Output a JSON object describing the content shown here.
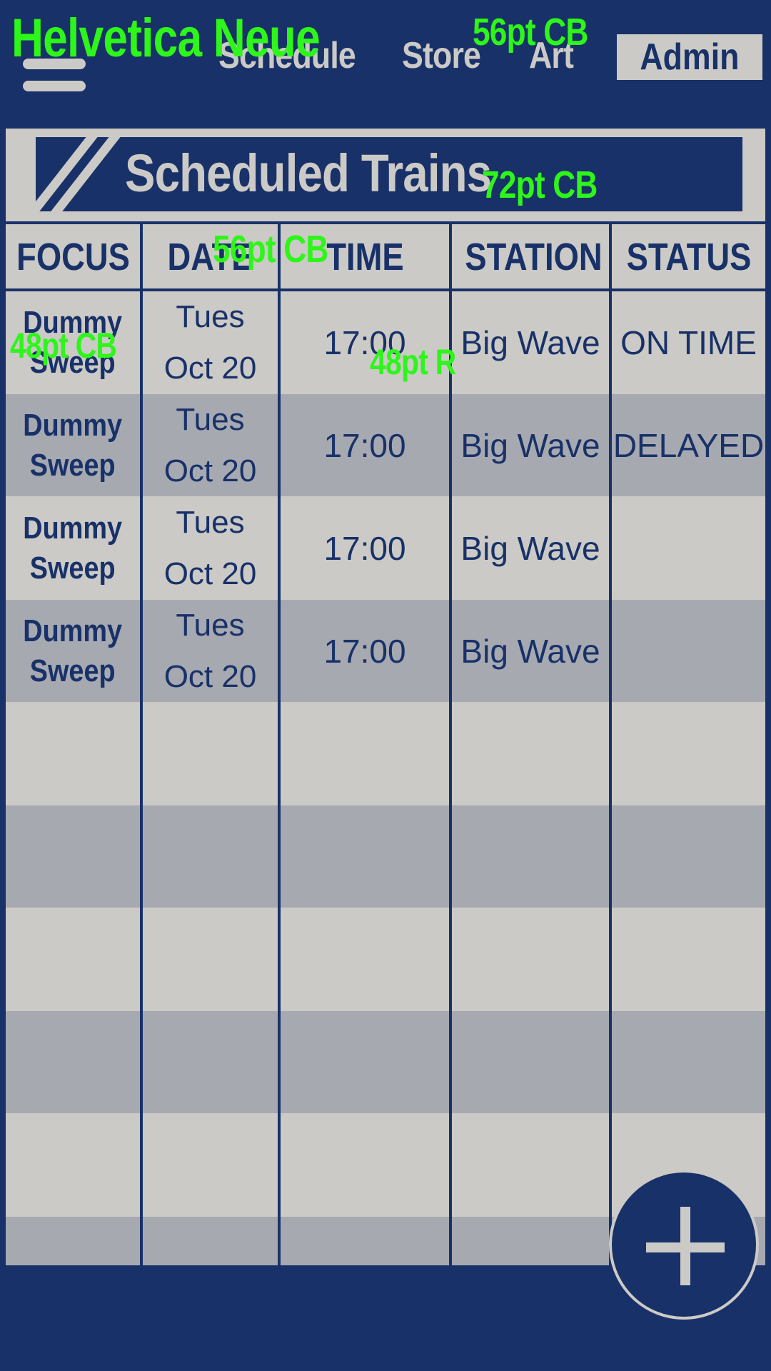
{
  "nav": {
    "items": [
      {
        "label": "Schedule"
      },
      {
        "label": "Store"
      },
      {
        "label": "Art"
      }
    ],
    "admin_label": "Admin"
  },
  "panel": {
    "title": "Scheduled Trains"
  },
  "table": {
    "columns": [
      "FOCUS",
      "DATE",
      "TIME",
      "STATION",
      "STATUS"
    ],
    "rows": [
      {
        "focus_line1": "Dummy",
        "focus_line2": "Sweep",
        "date_line1": "Tues",
        "date_line2": "Oct 20",
        "time": "17:00",
        "station": "Big Wave",
        "status": "ON TIME"
      },
      {
        "focus_line1": "Dummy",
        "focus_line2": "Sweep",
        "date_line1": "Tues",
        "date_line2": "Oct 20",
        "time": "17:00",
        "station": "Big Wave",
        "status": "DELAYED"
      },
      {
        "focus_line1": "Dummy",
        "focus_line2": "Sweep",
        "date_line1": "Tues",
        "date_line2": "Oct 20",
        "time": "17:00",
        "station": "Big Wave",
        "status": ""
      },
      {
        "focus_line1": "Dummy",
        "focus_line2": "Sweep",
        "date_line1": "Tues",
        "date_line2": "Oct 20",
        "time": "17:00",
        "station": "Big Wave",
        "status": ""
      }
    ]
  },
  "annotations": {
    "font": "Helvetica Neue",
    "nav_size": "56pt CB",
    "title_size": "72pt CB",
    "header_size": "56pt CB",
    "focus_size": "48pt CB",
    "cell_size": "48pt R"
  },
  "icons": {
    "menu": "hamburger-menu-icon",
    "add": "plus-icon"
  },
  "colors": {
    "navy": "#183168",
    "light_gray": "#cccac6",
    "band_gray": "#a7a9b1",
    "annotation_green": "#2ef51a"
  }
}
